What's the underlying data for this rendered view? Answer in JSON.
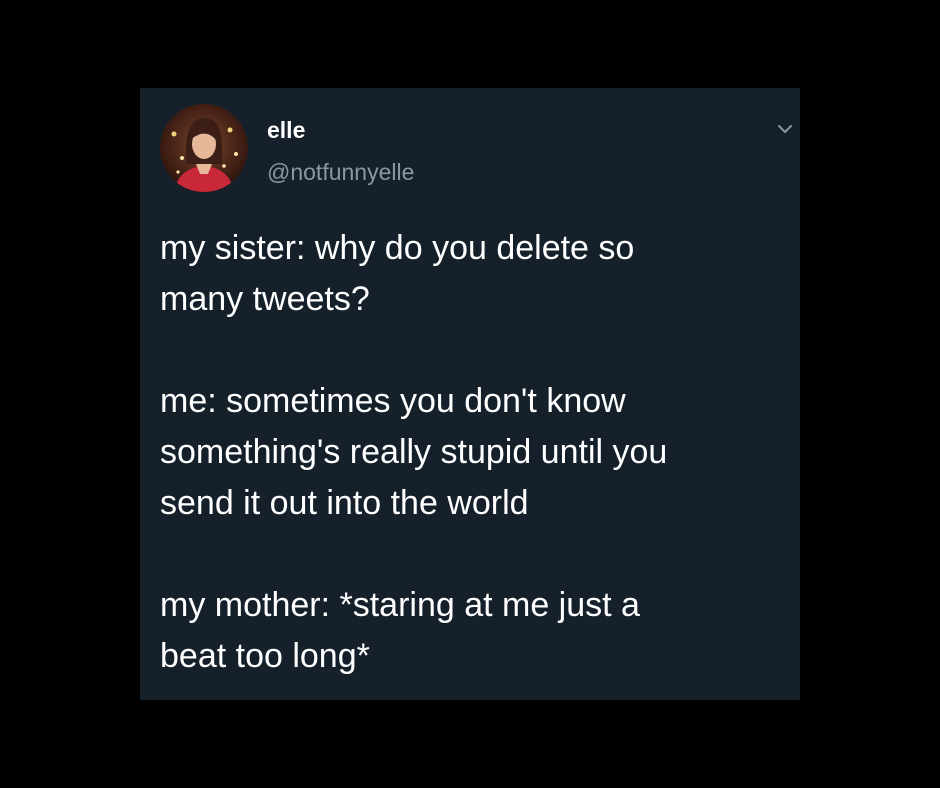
{
  "tweet": {
    "display_name": "elle",
    "handle": "@notfunnyelle",
    "paragraphs": [
      "my sister: why do you delete so\nmany tweets?",
      "me: sometimes you don't know\nsomething's really stupid until you\nsend it out into the world",
      "my mother: *staring at me just a\nbeat too long*"
    ],
    "avatar_icon": "profile-photo",
    "menu_icon": "chevron-down-icon"
  },
  "colors": {
    "page_background": "#000000",
    "card_background": "#15202b",
    "primary_text": "#ffffff",
    "secondary_text": "#8899a6"
  }
}
